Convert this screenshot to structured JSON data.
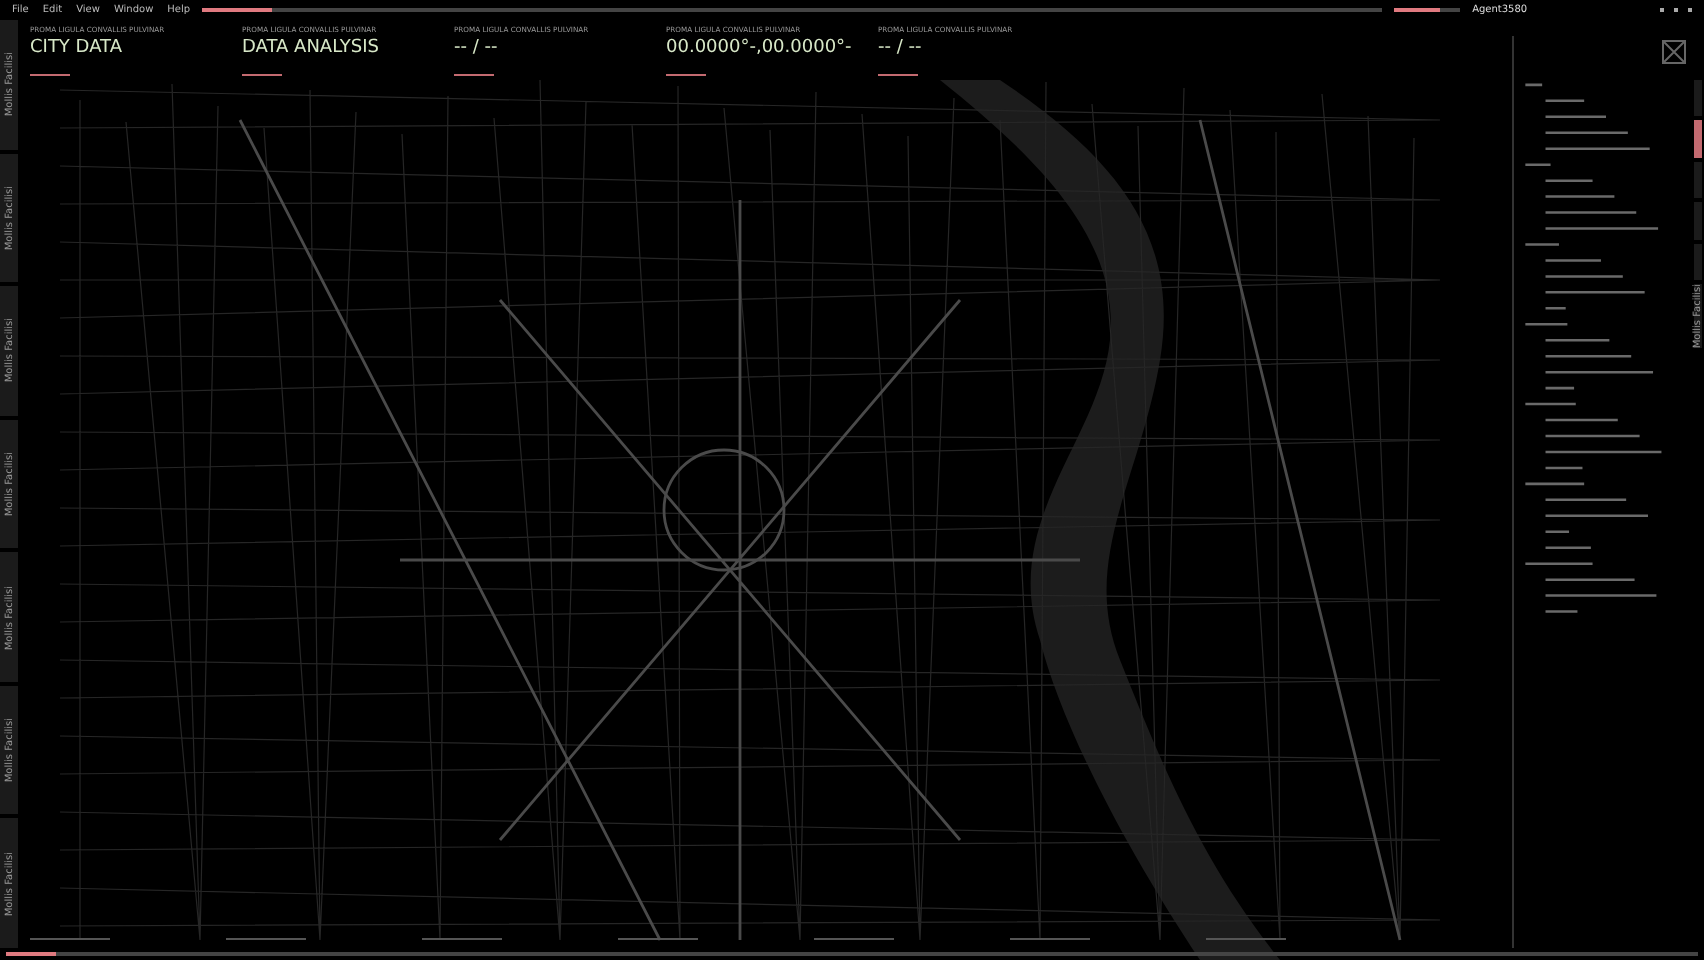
{
  "menu": [
    "File",
    "Edit",
    "View",
    "Window",
    "Help"
  ],
  "timeline": {
    "level": 0.06
  },
  "meter": {
    "level": 0.7
  },
  "agent": "Agent3580",
  "panels": [
    {
      "caption": "PROMA LIGULA CONVALLIS PULVINAR",
      "value": "CITY DATA"
    },
    {
      "caption": "PROMA LIGULA CONVALLIS PULVINAR",
      "value": "DATA ANALYSIS"
    },
    {
      "caption": "PROMA LIGULA CONVALLIS PULVINAR",
      "value": "-- / --"
    },
    {
      "caption": "PROMA LIGULA CONVALLIS PULVINAR",
      "value": "00.0000°-,00.0000°-"
    },
    {
      "caption": "PROMA LIGULA CONVALLIS PULVINAR",
      "value": "-- / --"
    }
  ],
  "side_tabs": [
    {
      "label": "Mollis Facilisi",
      "selected": false
    },
    {
      "label": "Mollis Facilisi",
      "selected": false
    },
    {
      "label": "Mollis Facilisi",
      "selected": false
    },
    {
      "label": "Mollis Facilisi",
      "selected": false
    },
    {
      "label": "Mollis Facilisi",
      "selected": false
    },
    {
      "label": "Mollis Facilisi",
      "selected": false
    },
    {
      "label": "Mollis Facilisi",
      "selected": false
    }
  ],
  "right_tabs": [
    {
      "selected": false
    },
    {
      "selected": true
    },
    {
      "selected": false
    },
    {
      "selected": false
    },
    {
      "selected": false
    },
    {
      "label": "Mollis Facilisi",
      "selected": false
    }
  ],
  "progress": {
    "level": 0.03
  }
}
